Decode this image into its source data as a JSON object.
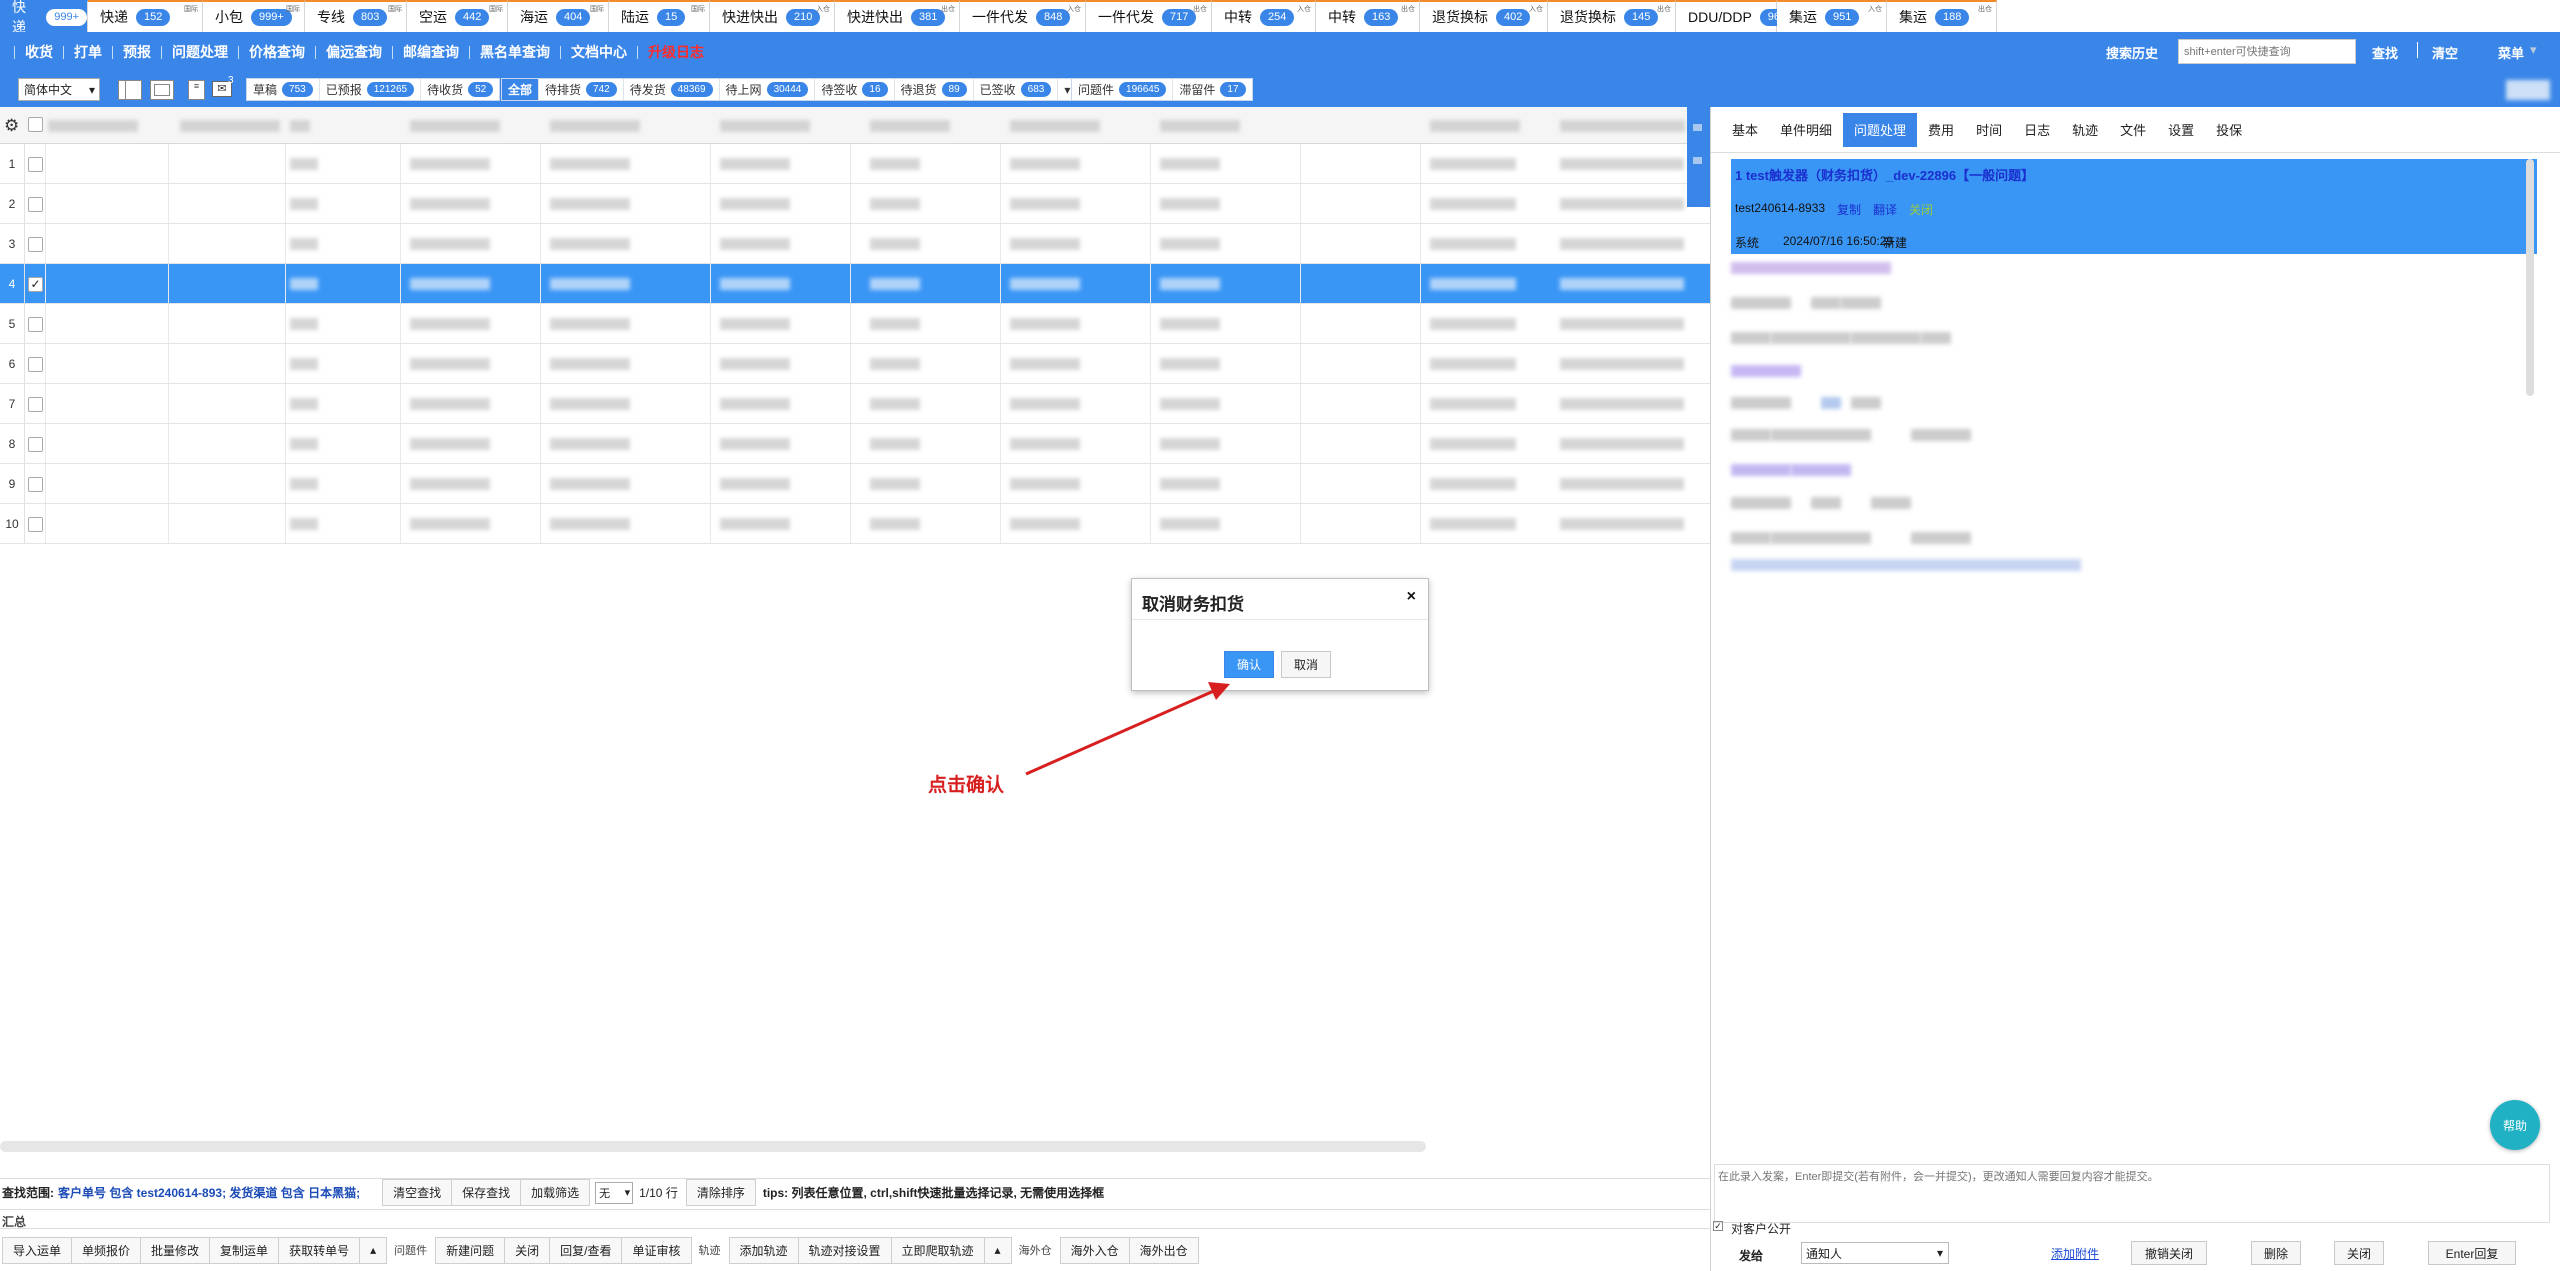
{
  "top_tabs": [
    {
      "label": "快递",
      "count": "999+",
      "active": true
    },
    {
      "label": "快递",
      "count": "152",
      "sup": "国际"
    },
    {
      "label": "小包",
      "count": "999+",
      "sup": "国际"
    },
    {
      "label": "专线",
      "count": "803",
      "sup": "国际"
    },
    {
      "label": "空运",
      "count": "442",
      "sup": "国际"
    },
    {
      "label": "海运",
      "count": "404",
      "sup": "国际"
    },
    {
      "label": "陆运",
      "count": "15",
      "sup": "国际"
    },
    {
      "label": "快进快出",
      "count": "210",
      "sup": "入仓"
    },
    {
      "label": "快进快出",
      "count": "381",
      "sup": "出仓"
    },
    {
      "label": "一件代发",
      "count": "848",
      "sup": "入仓"
    },
    {
      "label": "一件代发",
      "count": "717",
      "sup": "出仓"
    },
    {
      "label": "中转",
      "count": "254",
      "sup": "入仓"
    },
    {
      "label": "中转",
      "count": "163",
      "sup": "出仓"
    },
    {
      "label": "退货换标",
      "count": "402",
      "sup": "入仓"
    },
    {
      "label": "退货换标",
      "count": "145",
      "sup": "出仓"
    },
    {
      "label": "DDU/DDP",
      "count": "96"
    },
    {
      "label": "集运",
      "count": "951",
      "sup": "入仓"
    },
    {
      "label": "集运",
      "count": "188",
      "sup": "出仓"
    }
  ],
  "menu": [
    "收货",
    "打单",
    "预报",
    "问题处理",
    "价格查询",
    "偏远查询",
    "邮编查询",
    "黑名单查询",
    "文档中心"
  ],
  "menu_red": "升级日志",
  "search": {
    "history_label": "搜索历史",
    "placeholder": "shift+enter可快捷查询",
    "find_label": "查找",
    "clear_label": "清空",
    "menu_label": "菜单"
  },
  "toolbar": {
    "language": "简体中文",
    "mail_badge": "3"
  },
  "status_left": [
    {
      "label": "草稿",
      "count": "753"
    },
    {
      "label": "已预报",
      "count": "121265"
    },
    {
      "label": "待收货",
      "count": "52"
    }
  ],
  "status_mid": {
    "all_label": "全部",
    "items": [
      {
        "label": "待排货",
        "count": "742"
      },
      {
        "label": "待发货",
        "count": "48369"
      },
      {
        "label": "待上网",
        "count": "30444"
      },
      {
        "label": "待签收",
        "count": "16"
      },
      {
        "label": "待退货",
        "count": "89"
      },
      {
        "label": "已签收",
        "count": "683"
      }
    ]
  },
  "status_right": [
    {
      "label": "问题件",
      "count": "196645"
    },
    {
      "label": "滞留件",
      "count": "17"
    }
  ],
  "rows": [
    {
      "n": "1"
    },
    {
      "n": "2"
    },
    {
      "n": "3"
    },
    {
      "n": "4",
      "selected": true
    },
    {
      "n": "5"
    },
    {
      "n": "6"
    },
    {
      "n": "7"
    },
    {
      "n": "8"
    },
    {
      "n": "9"
    },
    {
      "n": "10"
    }
  ],
  "right_tabs": [
    {
      "label": "基本"
    },
    {
      "label": "单件明细"
    },
    {
      "label": "问题处理",
      "active": true
    },
    {
      "label": "费用"
    },
    {
      "label": "时间"
    },
    {
      "label": "日志"
    },
    {
      "label": "轨迹"
    },
    {
      "label": "文件"
    },
    {
      "label": "设置"
    },
    {
      "label": "投保"
    }
  ],
  "issue": {
    "title": "1  test触发器（财务扣货）_dev-22896【一般问题】",
    "order": "test240614-8933",
    "copy": "复制",
    "translate": "翻译",
    "close": "关闭",
    "user": "系统",
    "time": "2024/07/16 16:50:29",
    "status": "新建"
  },
  "modal": {
    "title": "取消财务扣货",
    "close": "×",
    "confirm": "确认",
    "cancel": "取消"
  },
  "annotation": "点击确认",
  "help": "帮助",
  "bottom": {
    "query_label": "查找范围:",
    "query_text": "客户单号 包含 test240614-893; 发货渠道 包含 日本黑猫;",
    "clear_find": "清空查找",
    "save_find": "保存查找",
    "load_filter": "加载筛选",
    "none": "无",
    "page": "1/10 行",
    "clear_sort": "清除排序",
    "tips": "tips: 列表任意位置, ctrl,shift快速批量选择记录, 无需使用选择框",
    "sum": "汇总",
    "actions": [
      "导入运单",
      "单频报价",
      "批量修改",
      "复制运单",
      "获取转单号"
    ],
    "problem_group": "问题件",
    "problem_actions": [
      "新建问题",
      "关闭",
      "回复/查看",
      "单证审核"
    ],
    "track_group": "轨迹",
    "track_actions": [
      "添加轨迹",
      "轨迹对接设置",
      "立即爬取轨迹"
    ],
    "overseas_group": "海外仓",
    "overseas_actions": [
      "海外入仓",
      "海外出仓"
    ]
  },
  "reply": {
    "placeholder": "在此录入发案，Enter即提交(若有附件，会一并提交)，更改通知人需要回复内容才能提交。",
    "public_label": "对客户公开",
    "send_to_label": "发给",
    "notify": "通知人",
    "attach": "添加附件",
    "undo_close": "撤销关闭",
    "delete": "删除",
    "close": "关闭",
    "enter_reply": "Enter回复"
  }
}
